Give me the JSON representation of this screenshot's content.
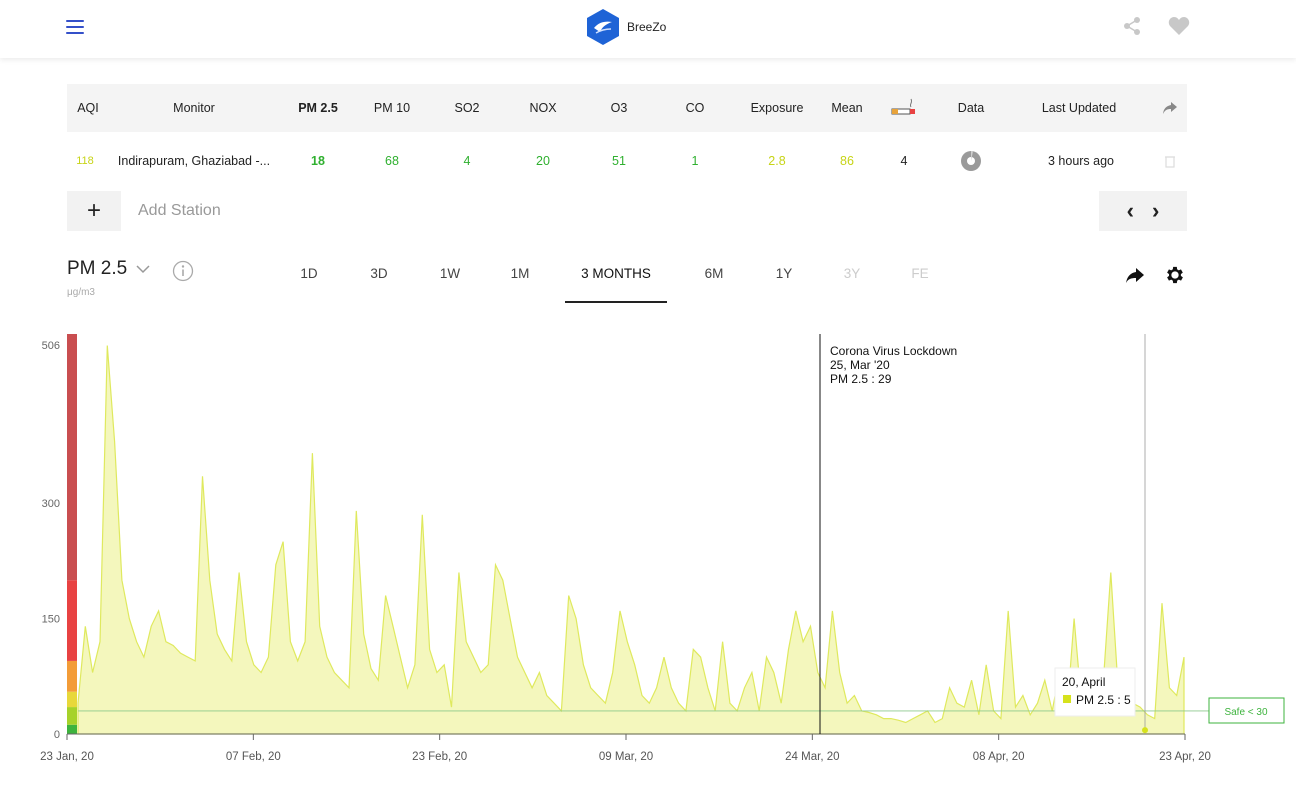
{
  "header": {
    "app_name": "BreeZo",
    "brand_color": "#1e63d6"
  },
  "table": {
    "columns": [
      "AQI",
      "Monitor",
      "PM 2.5",
      "PM 10",
      "SO2",
      "NOX",
      "O3",
      "CO",
      "Exposure",
      "Mean",
      "",
      "Data",
      "Last Updated"
    ],
    "row": {
      "aqi": "118",
      "monitor": "Indirapuram, Ghaziabad -...",
      "pm25": "18",
      "pm10": "68",
      "so2": "4",
      "nox": "20",
      "o3": "51",
      "co": "1",
      "exposure": "2.8",
      "mean": "86",
      "cigarettes": "4",
      "last_updated": "3 hours ago"
    },
    "add_station_placeholder": "Add Station",
    "add_symbol": "+",
    "prev_symbol": "‹",
    "next_symbol": "›"
  },
  "controls": {
    "pollutant": "PM 2.5",
    "unit": "μg/m3",
    "tabs": [
      "1D",
      "3D",
      "1W",
      "1M",
      "3 MONTHS",
      "6M",
      "1Y",
      "3Y",
      "FE"
    ],
    "active_tab": "3 MONTHS"
  },
  "chart_data": {
    "type": "area",
    "series": [
      {
        "values": [
          40,
          140,
          80,
          120,
          505,
          380,
          200,
          150,
          120,
          100,
          140,
          160,
          120,
          115,
          105,
          100,
          95,
          335,
          200,
          130,
          110,
          95,
          210,
          120,
          90,
          80,
          100,
          220,
          250,
          120,
          95,
          120,
          365,
          140,
          100,
          80,
          70,
          60,
          290,
          130,
          85,
          70,
          180,
          140,
          100,
          60,
          90,
          285,
          110,
          80,
          90,
          35,
          210,
          120,
          100,
          80,
          90,
          220,
          200,
          150,
          100,
          80,
          60,
          80,
          50,
          40,
          30,
          180,
          150,
          90,
          60,
          50,
          40,
          80,
          160,
          120,
          90,
          50,
          40,
          60,
          100,
          60,
          40,
          30,
          110,
          100,
          60,
          30,
          120,
          40,
          30,
          60,
          80,
          30,
          100,
          80,
          40,
          110,
          160,
          120,
          140,
          80,
          60,
          160,
          80,
          40,
          50,
          30,
          28,
          25,
          20,
          20,
          18,
          15,
          20,
          25,
          30,
          15,
          20,
          60,
          40,
          35,
          70,
          25,
          90,
          30,
          20,
          160,
          35,
          50,
          25,
          40,
          70,
          30,
          80,
          25,
          150,
          40,
          30,
          60,
          70,
          210,
          60,
          50,
          40,
          35,
          25,
          20,
          170,
          60,
          50,
          100
        ],
        "color": "#e2ee6a"
      }
    ],
    "x_ticks": [
      "23 Jan, 20",
      "07 Feb, 20",
      "23 Feb, 20",
      "09 Mar, 20",
      "24 Mar, 20",
      "08 Apr, 20",
      "23 Apr, 20"
    ],
    "y_ticks": [
      0,
      150,
      300,
      506
    ],
    "ylim": [
      0,
      520
    ],
    "annotation": {
      "title": "Corona Virus Lockdown",
      "date": "25, Mar '20",
      "value_text": "PM 2.5 : 29"
    },
    "tooltip": {
      "date": "20, April",
      "value_text": "PM 2.5 : 5"
    },
    "threshold": {
      "value": 30,
      "label": "Safe < 30",
      "color": "#3db33d"
    },
    "aqi_scale_colors": [
      "#3db33d",
      "#a6d22a",
      "#e8d83a",
      "#f39c38",
      "#e84242",
      "#c94e50"
    ]
  }
}
